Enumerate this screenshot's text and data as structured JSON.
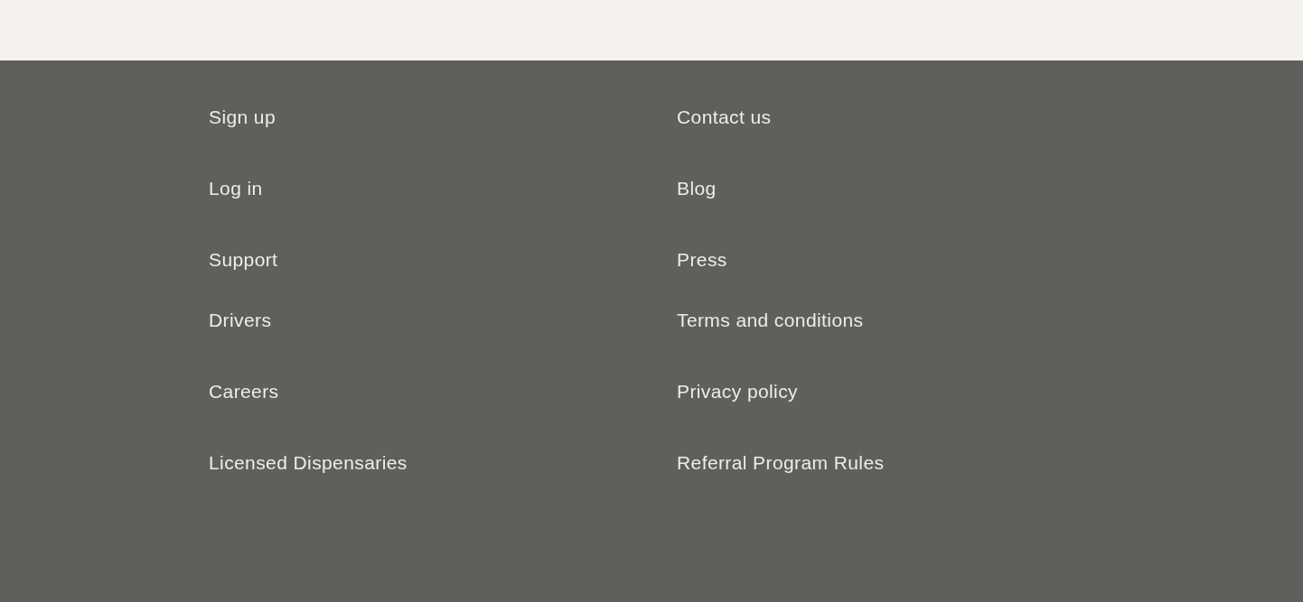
{
  "footer": {
    "sections": [
      {
        "columns": [
          [
            "Sign up",
            "Log in",
            "Support"
          ],
          [
            "Contact us",
            "Blog",
            "Press"
          ]
        ]
      },
      {
        "columns": [
          [
            "Drivers",
            "Careers",
            "Licensed Dispensaries"
          ],
          [
            "Terms and conditions",
            "Privacy policy",
            "Referral Program Rules"
          ]
        ]
      }
    ]
  }
}
